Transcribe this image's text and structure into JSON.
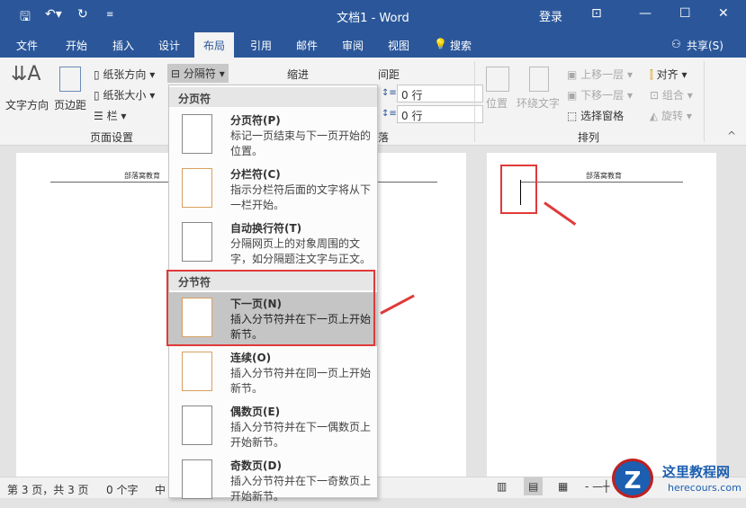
{
  "title": "文档1 - Word",
  "titlebar": {
    "login": "登录",
    "icons": [
      "save-icon",
      "undo-icon",
      "redo-icon",
      "customize-icon",
      "ribbon-display-icon",
      "minimize-icon",
      "maximize-icon",
      "close-icon"
    ]
  },
  "tabs": [
    "文件",
    "开始",
    "插入",
    "设计",
    "布局",
    "引用",
    "邮件",
    "审阅",
    "视图"
  ],
  "search": "搜索",
  "share": "共享(S)",
  "ribbon": {
    "text_direction": "文字方向",
    "margins": "页边距",
    "orientation": "纸张方向",
    "size": "纸张大小",
    "columns": "栏",
    "breaks": "分隔符",
    "page_setup": "页面设置",
    "indent": "缩进",
    "spacing": "间距",
    "spacing_before": "0 行",
    "spacing_after": "0 行",
    "paragraph_group_tail": "落",
    "position": "位置",
    "wrap_text": "环绕文字",
    "bring_forward": "上移一层",
    "send_backward": "下移一层",
    "selection_pane": "选择窗格",
    "align": "对齐",
    "group": "组合",
    "rotate": "旋转",
    "arrange": "排列"
  },
  "menu": {
    "header_page": "分页符",
    "page_items": [
      {
        "name": "分页符(P)",
        "desc": "标记一页结束与下一页开始的位置。"
      },
      {
        "name": "分栏符(C)",
        "desc": "指示分栏符后面的文字将从下一栏开始。"
      },
      {
        "name": "自动换行符(T)",
        "desc": "分隔网页上的对象周围的文字，如分隔题注文字与正文。"
      }
    ],
    "header_section": "分节符",
    "section_items": [
      {
        "name": "下一页(N)",
        "desc": "插入分节符并在下一页上开始新节。"
      },
      {
        "name": "连续(O)",
        "desc": "插入分节符并在同一页上开始新节。"
      },
      {
        "name": "偶数页(E)",
        "desc": "插入分节符并在下一偶数页上开始新节。"
      },
      {
        "name": "奇数页(D)",
        "desc": "插入分节符并在下一奇数页上开始新节。"
      }
    ]
  },
  "doc": {
    "header_text": "部落窝教育"
  },
  "status": {
    "page": "第 3 页，共 3 页",
    "words": "0 个字",
    "lang": "中"
  },
  "watermark": {
    "title": "这里教程网",
    "url": "herecours.com"
  }
}
